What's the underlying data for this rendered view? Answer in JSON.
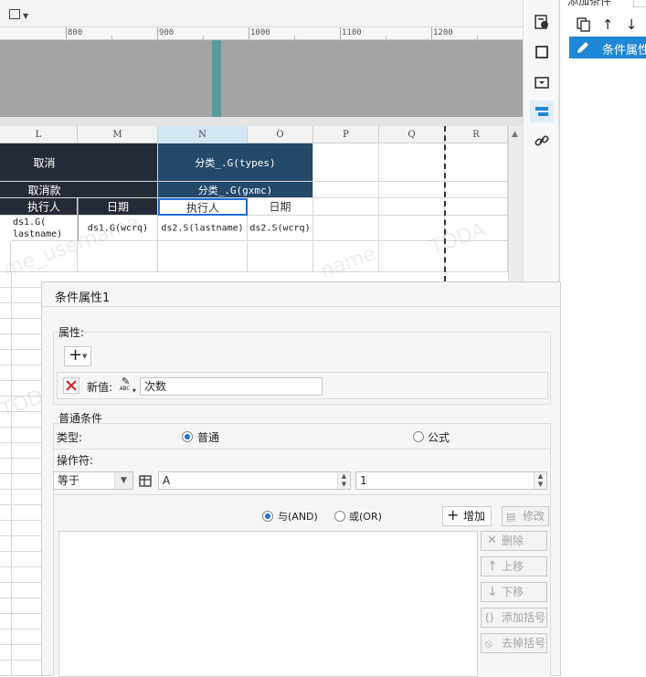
{
  "ruler": {
    "labels": [
      "800",
      "900",
      "1000",
      "1100",
      "1200"
    ]
  },
  "sheet": {
    "columns": [
      "L",
      "M",
      "N",
      "O",
      "P",
      "Q",
      "R"
    ],
    "active_column": "N",
    "cells": {
      "r1_lm": "取消",
      "r1_n": "分类_.G(types)",
      "r2_lm": "取消款",
      "r2_n": "分类_.G(gxmc)",
      "r3_l": "执行人",
      "r3_m": "日期",
      "r3_n": "执行人",
      "r3_o": "日期",
      "r4_l": "ds1.G( lastname)",
      "r4_m": "ds1.G(wcrq)",
      "r4_n": "ds2.S(lastname)",
      "r4_o": "ds2.S(wcrq)"
    },
    "watermark": [
      "me_username",
      "name",
      "TODA"
    ]
  },
  "right_panel": {
    "title": "添加条件",
    "selected_item": "条件属性"
  },
  "dialog": {
    "title": "条件属性1",
    "property_section": "属性:",
    "new_value_label": "新值:",
    "new_value_type": "ABC",
    "new_value": "次数",
    "common_condition": "普通条件",
    "type_label": "类型:",
    "type_common": "普通",
    "type_formula": "公式",
    "operator_label": "操作符:",
    "operator_value": "等于",
    "operand_a": "A",
    "operand_b": "1",
    "and_label": "与(AND)",
    "or_label": "或(OR)",
    "add_button": "增加",
    "modify_button": "修改",
    "delete_button": "删除",
    "move_up_button": "上移",
    "move_down_button": "下移",
    "add_bracket_button": "添加括号",
    "remove_bracket_button": "去掉括号"
  },
  "colors": {
    "accent": "#1e88d6",
    "header_dark": "#252b36",
    "header_blue": "#23496b",
    "canvas_gray": "#a4a4a4"
  }
}
